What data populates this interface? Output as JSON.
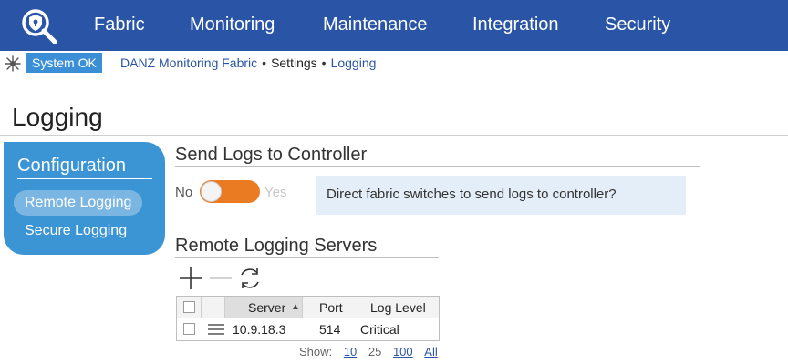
{
  "nav": {
    "items": [
      {
        "label": "Fabric"
      },
      {
        "label": "Monitoring"
      },
      {
        "label": "Maintenance"
      },
      {
        "label": "Integration"
      },
      {
        "label": "Security"
      }
    ],
    "logo_icon": "search-shield-logo-icon"
  },
  "status": {
    "badge": "System OK",
    "icon": "bug-icon"
  },
  "breadcrumb": {
    "items": [
      "DANZ Monitoring Fabric",
      "Settings",
      "Logging"
    ],
    "separator": "•"
  },
  "page": {
    "title": "Logging"
  },
  "sidebar": {
    "title": "Configuration",
    "items": [
      {
        "label": "Remote Logging",
        "active": true
      },
      {
        "label": "Secure Logging",
        "active": false
      }
    ]
  },
  "send_logs": {
    "title": "Send Logs to Controller",
    "toggle_off_label": "No",
    "toggle_on_label": "Yes",
    "toggle_state": "No",
    "help_text": "Direct fabric switches to send logs to controller?"
  },
  "servers": {
    "title": "Remote Logging Servers",
    "toolbar": {
      "add_icon": "plus-icon",
      "remove_icon": "minus-icon",
      "refresh_icon": "refresh-icon"
    },
    "columns": {
      "server": "Server",
      "port": "Port",
      "log_level": "Log Level",
      "sort_indicator": "▲"
    },
    "rows": [
      {
        "server": "10.9.18.3",
        "port": "514",
        "log_level": "Critical"
      }
    ],
    "pager": {
      "label": "Show:",
      "options": [
        "10",
        "25",
        "100",
        "All"
      ],
      "current": "25"
    }
  },
  "colors": {
    "nav_bg": "#2a55a6",
    "panel_bg": "#3b94d4",
    "toggle": "#ea7b23",
    "status_badge": "#3a8fd6",
    "help_bg": "#e4eef8"
  }
}
